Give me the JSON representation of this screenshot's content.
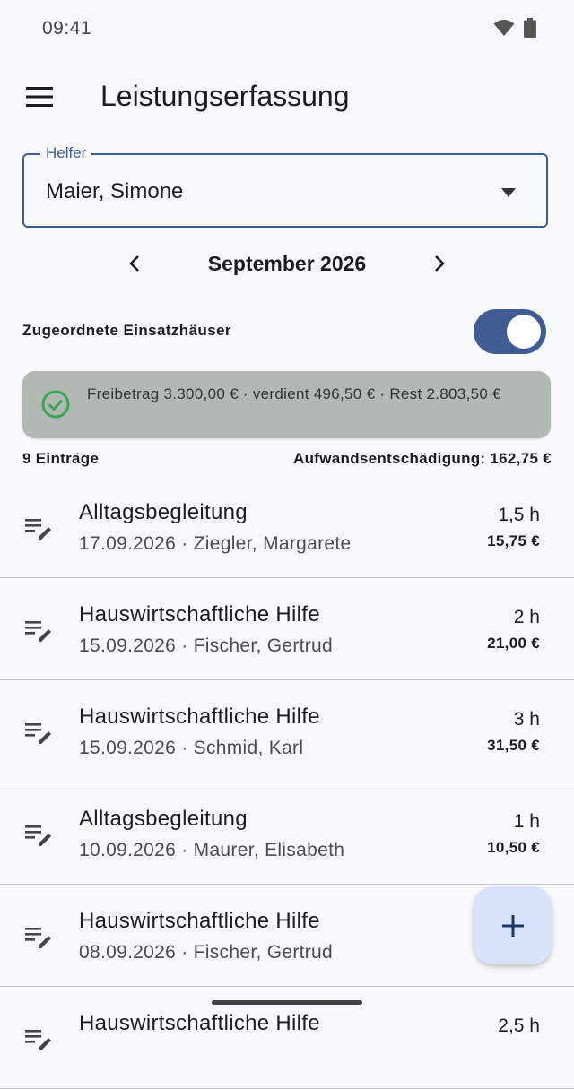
{
  "status_bar": {
    "time": "09:41",
    "icons": [
      "wifi-icon",
      "battery-icon"
    ]
  },
  "app_bar": {
    "menu_icon": "menu-icon",
    "title": "Leistungserfassung"
  },
  "helper_field": {
    "label": "Helfer",
    "value": "Maier, Simone",
    "dropdown_icon": "arrow-drop-down-icon"
  },
  "month_nav": {
    "label": "September 2026",
    "prev_icon": "chevron-left-icon",
    "next_icon": "chevron-right-icon"
  },
  "toggle": {
    "label": "Zugeordnete Einsatzhäuser",
    "on": true
  },
  "summary": {
    "icon": "check-circle-icon",
    "text": "Freibetrag 3.300,00 € · verdient 496,50 € · Rest 2.803,50 €"
  },
  "counts": {
    "entries": "9 Einträge",
    "compensation": "Aufwandsentschädigung: 162,75 €"
  },
  "entries": [
    {
      "title": "Alltagsbegleitung",
      "subtitle": "17.09.2026 · Ziegler, Margarete",
      "hours": "1,5 h",
      "amount": "15,75 €"
    },
    {
      "title": "Hauswirtschaftliche Hilfe",
      "subtitle": "15.09.2026 · Fischer, Gertrud",
      "hours": "2 h",
      "amount": "21,00 €"
    },
    {
      "title": "Hauswirtschaftliche Hilfe",
      "subtitle": "15.09.2026 · Schmid, Karl",
      "hours": "3 h",
      "amount": "31,50 €"
    },
    {
      "title": "Alltagsbegleitung",
      "subtitle": "10.09.2026 · Maurer, Elisabeth",
      "hours": "1 h",
      "amount": "10,50 €"
    },
    {
      "title": "Hauswirtschaftliche Hilfe",
      "subtitle": "08.09.2026 · Fischer, Gertrud",
      "hours": "",
      "amount": ""
    },
    {
      "title": "Hauswirtschaftliche Hilfe",
      "subtitle": "",
      "hours": "2,5 h",
      "amount": ""
    }
  ],
  "fab": {
    "icon": "add-icon"
  },
  "colors": {
    "primary": "#3f5d93",
    "summary_bg": "#b1b9b2",
    "check": "#3aa757",
    "fab_bg": "#d7e2fb"
  }
}
